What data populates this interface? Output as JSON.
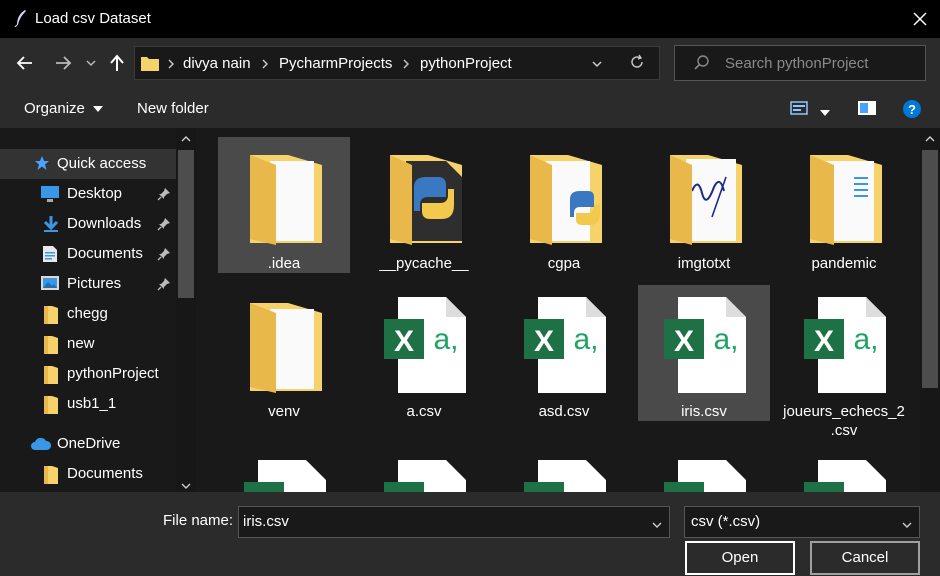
{
  "window": {
    "title": "Load csv Dataset"
  },
  "address": {
    "crumbs": [
      "divya nain",
      "PycharmProjects",
      "pythonProject"
    ]
  },
  "search": {
    "placeholder": "Search pythonProject"
  },
  "toolbar": {
    "organize_label": "Organize",
    "new_folder_label": "New folder"
  },
  "sidebar": {
    "items": [
      {
        "label": "Quick access",
        "icon": "star-icon",
        "pinned": false
      },
      {
        "label": "Desktop",
        "icon": "desktop-icon",
        "pinned": true
      },
      {
        "label": "Downloads",
        "icon": "download-icon",
        "pinned": true
      },
      {
        "label": "Documents",
        "icon": "document-icon",
        "pinned": true
      },
      {
        "label": "Pictures",
        "icon": "pictures-icon",
        "pinned": true
      },
      {
        "label": "chegg",
        "icon": "folder-icon",
        "pinned": false
      },
      {
        "label": "new",
        "icon": "folder-icon",
        "pinned": false
      },
      {
        "label": "pythonProject",
        "icon": "folder-icon",
        "pinned": false
      },
      {
        "label": "usb1_1",
        "icon": "folder-icon",
        "pinned": false
      },
      {
        "label": "OneDrive",
        "icon": "cloud-icon",
        "pinned": false
      },
      {
        "label": "Documents",
        "icon": "folder-icon",
        "pinned": false
      }
    ]
  },
  "files": [
    {
      "name": ".idea",
      "kind": "folder",
      "selected": true
    },
    {
      "name": "__pycache__",
      "kind": "python-folder",
      "selected": false
    },
    {
      "name": "cgpa",
      "kind": "python-folder-docs",
      "selected": false
    },
    {
      "name": "imgtotxt",
      "kind": "signature-folder",
      "selected": false
    },
    {
      "name": "pandemic",
      "kind": "docs-folder",
      "selected": false
    },
    {
      "name": "venv",
      "kind": "folder",
      "selected": false
    },
    {
      "name": "a.csv",
      "kind": "csv",
      "selected": false
    },
    {
      "name": "asd.csv",
      "kind": "csv",
      "selected": false
    },
    {
      "name": "iris.csv",
      "kind": "csv",
      "selected": true
    },
    {
      "name": "joueurs_echecs_2\n.csv",
      "kind": "csv",
      "selected": false
    },
    {
      "name": "",
      "kind": "csv",
      "selected": false
    },
    {
      "name": "",
      "kind": "csv",
      "selected": false
    },
    {
      "name": "",
      "kind": "csv",
      "selected": false
    },
    {
      "name": "",
      "kind": "csv",
      "selected": false
    },
    {
      "name": "",
      "kind": "csv",
      "selected": false
    }
  ],
  "filename": {
    "label": "File name:",
    "value": "iris.csv"
  },
  "filetype": {
    "value": "csv (*.csv)"
  },
  "buttons": {
    "open": "Open",
    "cancel": "Cancel"
  },
  "colors": {
    "excel_green": "#1e7145",
    "excel_teal": "#21a366",
    "folder_yellow": "#f6d36a",
    "accent_blue": "#0078d7"
  }
}
